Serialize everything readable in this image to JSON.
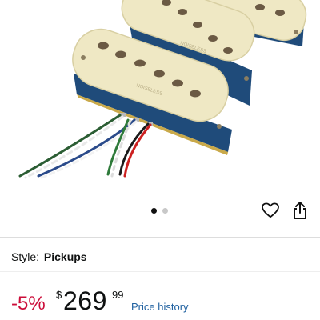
{
  "product_image": {
    "description_icon": "guitar-pickups-photo",
    "pickup_text": "NOISELESS"
  },
  "carousel": {
    "total": 2,
    "active_index": 0
  },
  "actions": {
    "wishlist_icon": "heart-outline-icon",
    "share_icon": "share-icon"
  },
  "style": {
    "label": "Style:",
    "value": "Pickups"
  },
  "price": {
    "discount": "-5%",
    "currency": "$",
    "whole": "269",
    "fraction": "99",
    "history_link": "Price history"
  },
  "colors": {
    "discount": "#cc0c39",
    "link": "#2162a1",
    "pickup_cover": "#efe8c4",
    "baseplate": "#1f4b7a"
  }
}
